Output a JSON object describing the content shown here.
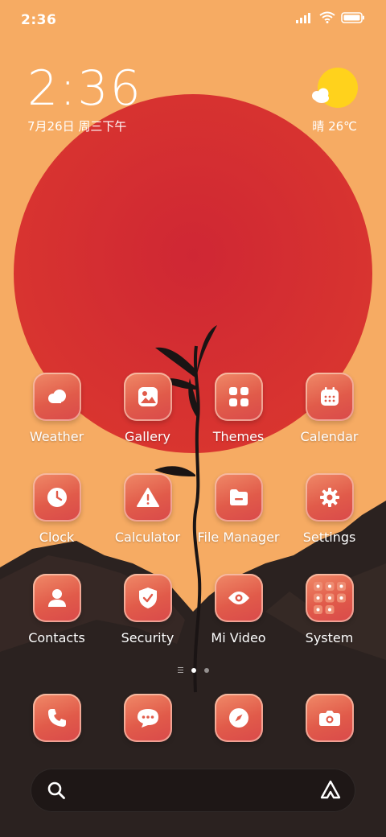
{
  "status_bar": {
    "time": "2:36",
    "icons": [
      "signal-icon",
      "wifi-icon",
      "battery-icon"
    ]
  },
  "clock_widget": {
    "time": "2:36",
    "date": "7月26日 周三下午"
  },
  "weather_widget": {
    "condition_temp": "晴 26℃",
    "icon": "sunny-cloud-icon"
  },
  "apps": [
    {
      "label": "Weather",
      "icon": "cloud-icon"
    },
    {
      "label": "Gallery",
      "icon": "image-icon"
    },
    {
      "label": "Themes",
      "icon": "grid-icon"
    },
    {
      "label": "Calendar",
      "icon": "calendar-icon"
    },
    {
      "label": "Clock",
      "icon": "clock-icon"
    },
    {
      "label": "Calculator",
      "icon": "warning-icon"
    },
    {
      "label": "File Manager",
      "icon": "folder-icon"
    },
    {
      "label": "Settings",
      "icon": "gear-icon"
    },
    {
      "label": "Contacts",
      "icon": "person-icon"
    },
    {
      "label": "Security",
      "icon": "shield-icon"
    },
    {
      "label": "Mi Video",
      "icon": "eye-icon"
    },
    {
      "label": "System",
      "icon": "folder-grid-icon"
    }
  ],
  "pager": {
    "pages": 2,
    "active": 1
  },
  "dock": [
    {
      "icon": "phone-icon"
    },
    {
      "icon": "message-icon"
    },
    {
      "icon": "compass-icon"
    },
    {
      "icon": "camera-icon"
    }
  ],
  "search_bar": {
    "left_icon": "search-icon",
    "right_icon": "assistant-icon"
  },
  "colors": {
    "background": "#f6ab63",
    "sun": "#d42f2e",
    "icon_accent": "#e15b4a"
  }
}
